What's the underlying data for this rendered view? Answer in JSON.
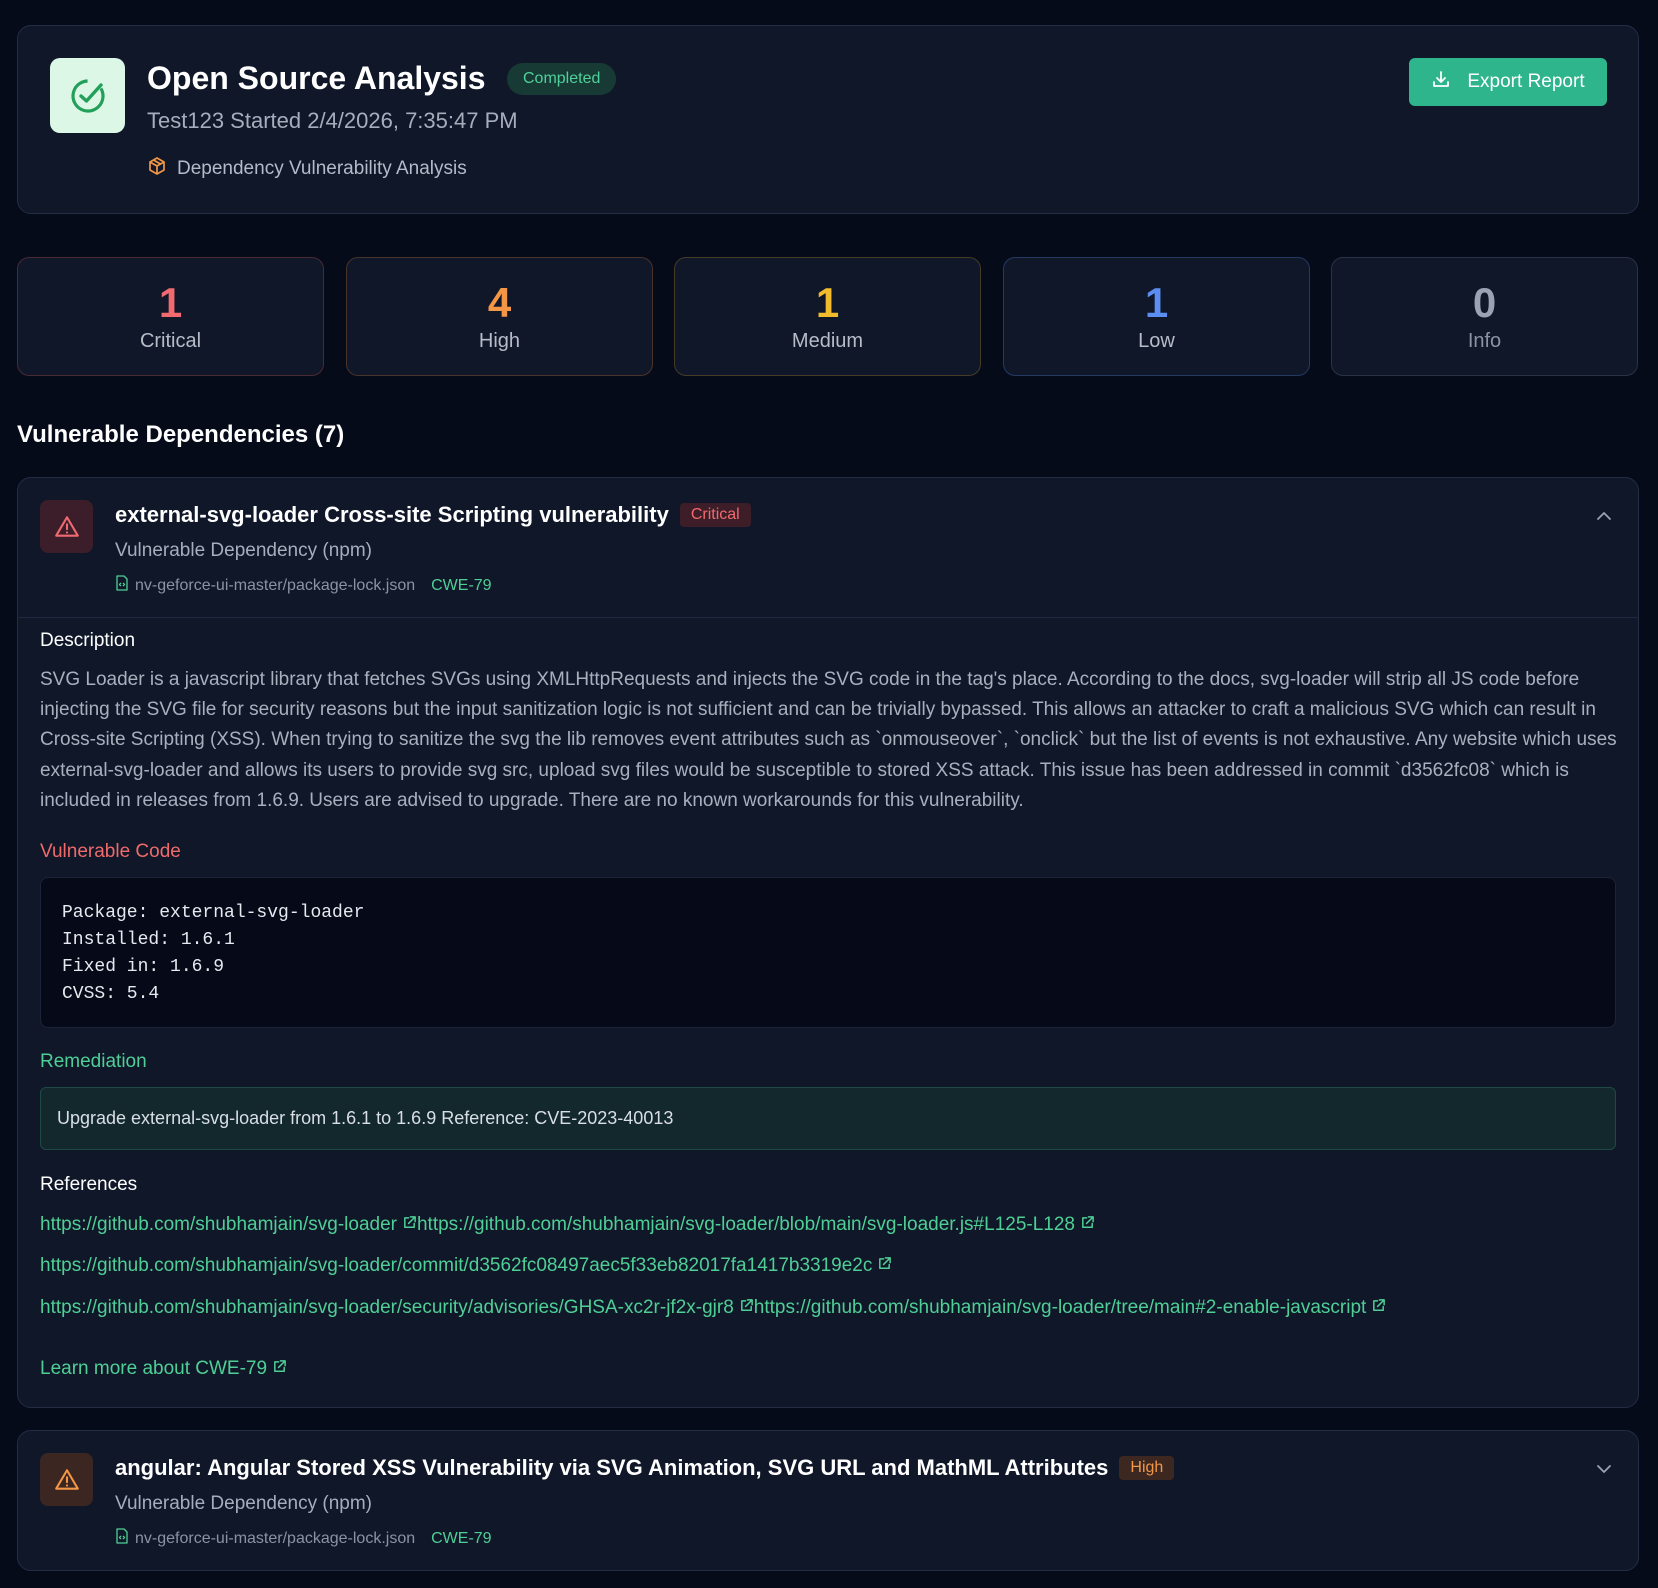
{
  "header": {
    "title": "Open Source Analysis",
    "status": "Completed",
    "meta": "Test123 Started 2/4/2026, 7:35:47 PM",
    "analysis_type": "Dependency Vulnerability Analysis",
    "export_label": "Export Report"
  },
  "stats": [
    {
      "count": "1",
      "label": "Critical",
      "color": "#f06a6f"
    },
    {
      "count": "4",
      "label": "High",
      "color": "#f39646"
    },
    {
      "count": "1",
      "label": "Medium",
      "color": "#f2bb2d"
    },
    {
      "count": "1",
      "label": "Low",
      "color": "#5b8ef0"
    },
    {
      "count": "0",
      "label": "Info",
      "color": "#9aa3b3"
    }
  ],
  "section_title": "Vulnerable Dependencies (7)",
  "vulns": [
    {
      "title": "external-svg-loader Cross-site Scripting vulnerability",
      "severity": "Critical",
      "type": "Vulnerable Dependency (npm)",
      "file": "nv-geforce-ui-master/package-lock.json",
      "cwe": "CWE-79",
      "description_title": "Description",
      "description": "SVG Loader is a javascript library that fetches SVGs using XMLHttpRequests and injects the SVG code in the tag's place. According to the docs, svg-loader will strip all JS code before injecting the SVG file for security reasons but the input sanitization logic is not sufficient and can be trivially bypassed. This allows an attacker to craft a malicious SVG which can result in Cross-site Scripting (XSS). When trying to sanitize the svg the lib removes event attributes such as `onmouseover`, `onclick` but the list of events is not exhaustive. Any website which uses external-svg-loader and allows its users to provide svg src, upload svg files would be susceptible to stored XSS attack. This issue has been addressed in commit `d3562fc08` which is included in releases from 1.6.9. Users are advised to upgrade. There are no known workarounds for this vulnerability.",
      "code_title": "Vulnerable Code",
      "code": "Package: external-svg-loader\nInstalled: 1.6.1\nFixed in: 1.6.9\nCVSS: 5.4",
      "remediation_title": "Remediation",
      "remediation": "Upgrade external-svg-loader from 1.6.1 to 1.6.9 Reference: CVE-2023-40013",
      "references_title": "References",
      "references": [
        "https://github.com/shubhamjain/svg-loader",
        "https://github.com/shubhamjain/svg-loader/blob/main/svg-loader.js#L125-L128",
        "https://github.com/shubhamjain/svg-loader/commit/d3562fc08497aec5f33eb82017fa1417b3319e2c",
        "https://github.com/shubhamjain/svg-loader/security/advisories/GHSA-xc2r-jf2x-gjr8",
        "https://github.com/shubhamjain/svg-loader/tree/main#2-enable-javascript"
      ],
      "learn_more": "Learn more about CWE-79"
    },
    {
      "title": "angular: Angular Stored XSS Vulnerability via SVG Animation, SVG URL and MathML Attributes",
      "severity": "High",
      "type": "Vulnerable Dependency (npm)",
      "file": "nv-geforce-ui-master/package-lock.json",
      "cwe": "CWE-79"
    }
  ],
  "colors": {
    "background": "#060b1a",
    "card": "#0f1729",
    "accent": "#2eb58b",
    "critical": "#f06a6f",
    "high": "#f39646"
  },
  "icons": {
    "logo": "check-circle-icon",
    "analysis_type": "package-icon",
    "export": "download-icon",
    "severity": "warning-triangle-icon",
    "file": "file-code-icon",
    "external_link": "external-link-icon"
  }
}
